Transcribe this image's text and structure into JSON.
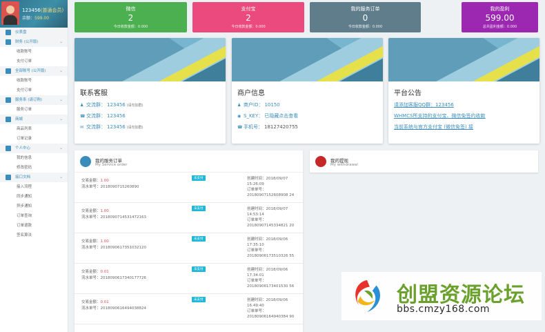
{
  "profile": {
    "name": "123456",
    "level": "(普通会员)",
    "balance_label": "余额：",
    "balance": "599.00"
  },
  "sidebar": {
    "items": [
      {
        "label": "仪表盘",
        "group": true
      },
      {
        "label": "财务 (公开版)",
        "group": true
      },
      {
        "label": "收款账号",
        "group": false
      },
      {
        "label": "支付订单",
        "group": false
      },
      {
        "label": "全部账号 (公开版)",
        "group": true
      },
      {
        "label": "收款账号",
        "group": false
      },
      {
        "label": "支付订单",
        "group": false
      },
      {
        "label": "服务系 (请订购)",
        "group": true
      },
      {
        "label": "服务订单",
        "group": false
      },
      {
        "label": "商城",
        "group": true
      },
      {
        "label": "商品列表",
        "group": false
      },
      {
        "label": "订单记录",
        "group": false
      },
      {
        "label": "个人中心",
        "group": true
      },
      {
        "label": "我的信息",
        "group": false
      },
      {
        "label": "修改密码",
        "group": false
      },
      {
        "label": "接口文档",
        "group": true
      },
      {
        "label": "接入流程",
        "group": false
      },
      {
        "label": "同步通知",
        "group": false
      },
      {
        "label": "异步通知",
        "group": false
      },
      {
        "label": "订单查询",
        "group": false
      },
      {
        "label": "订单退款",
        "group": false
      },
      {
        "label": "签名算法",
        "group": false
      }
    ]
  },
  "stats": [
    {
      "title": "微信",
      "value": "2",
      "sub": "今日收款金额：0.000",
      "color": "#4caf50"
    },
    {
      "title": "支付宝",
      "value": "2",
      "sub": "今日收款金额：0.000",
      "color": "#ea4a7d"
    },
    {
      "title": "我的服务订单",
      "value": "0",
      "sub": "今日收款金额：0.000",
      "color": "#607d8b"
    },
    {
      "title": "我的盈利",
      "value": "599.00",
      "sub": "总共盈利金额：0.000",
      "color": "#9c27b0"
    }
  ],
  "support_card": {
    "title": "联系客服",
    "rows": [
      {
        "key": "交流群：",
        "value": "123456",
        "tag": "(请勿加群)"
      },
      {
        "key": "交流群：",
        "value": "123456",
        "tag": ""
      },
      {
        "key": "交流群：",
        "value": "123456",
        "tag": "(请勿加群)"
      }
    ]
  },
  "merchant_card": {
    "title": "商户信息",
    "pid_label": "商户ID：",
    "pid": "10150",
    "key_label": "S_KEY：",
    "key": "已隐藏点击查看",
    "phone_label": "手机号：",
    "phone": "18127420755"
  },
  "notice_card": {
    "title": "平台公告",
    "links": [
      "请添加客服QQ群：123456",
      "WHMCS所支持的支付宝、微信免签约收款",
      "当前系统与官方支付宝 (微信免签) 接"
    ]
  },
  "orders_panel": {
    "title": "我的服务订单",
    "subtitle": "My Service order",
    "rows": [
      {
        "amount_label": "交易金额：",
        "amount": "1.00",
        "serial_label": "流水单号：",
        "serial": "2018090715260890",
        "status": "未支付",
        "created_label": "创建时间：",
        "created": "2018/09/07 15:26:09",
        "order_label": "订单单号：",
        "order": "20180907152608908 24"
      },
      {
        "amount_label": "交易金额：",
        "amount": "1.00",
        "serial_label": "流水单号：",
        "serial": "2018090714531472163",
        "status": "未支付",
        "created_label": "创建时间：",
        "created": "2018/09/07 14:53:14",
        "order_label": "订单单号：",
        "order": "20180907145334821 20"
      },
      {
        "amount_label": "交易金额：",
        "amount": "1.00",
        "serial_label": "流水单号：",
        "serial": "2018090617351032120",
        "status": "未支付",
        "created_label": "创建时间：",
        "created": "2018/09/06 17:35:10",
        "order_label": "订单单号：",
        "order": "20180906173510326 55"
      },
      {
        "amount_label": "交易金额：",
        "amount": "0.01",
        "serial_label": "流水单号：",
        "serial": "2018090617340177726",
        "status": "未支付",
        "created_label": "创建时间：",
        "created": "2018/09/06 17:34:01",
        "order_label": "订单单号：",
        "order": "20180906173401530 56"
      },
      {
        "amount_label": "交易金额：",
        "amount": "0.01",
        "serial_label": "流水单号：",
        "serial": "2018090616494038824",
        "status": "未支付",
        "created_label": "创建时间：",
        "created": "2018/09/06 16:49:40",
        "order_label": "订单单号：",
        "order": "20180906164940384 90"
      }
    ]
  },
  "withdraw_panel": {
    "title": "我的提现",
    "subtitle": "My withdrawal"
  },
  "watermark": {
    "text": "创盟资源论坛",
    "url": "bbs.cmzy168.com"
  }
}
